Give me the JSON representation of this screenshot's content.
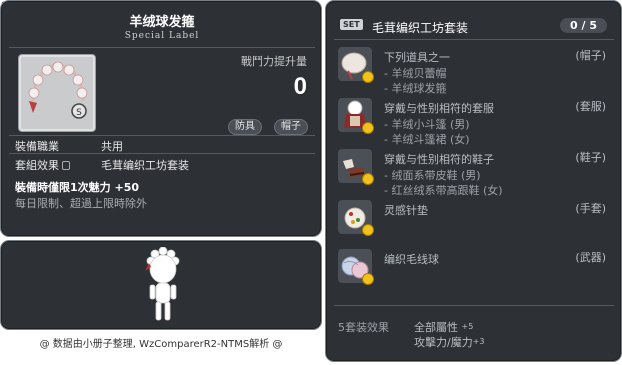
{
  "item_id": "01006161",
  "item": {
    "name": "羊绒球发箍",
    "label": "Special Label",
    "power_label": "戰鬥力提升量",
    "power_value": "0",
    "tags": [
      "防具",
      "帽子"
    ],
    "job_key": "裝備職業",
    "job_value": "共用",
    "set_key": "套組效果",
    "set_value": "毛茸编织工坊套装",
    "limit_text": "裝備時僅限1次魅力 +50",
    "reset_text": "每日限制、超過上限時除外"
  },
  "credit": "@ 数据由小册子整理, WzComparerR2-NTMS解析 @",
  "set": {
    "badge": "SET",
    "title": "毛茸编织工坊套装",
    "count": "0 / 5",
    "rows": [
      {
        "icon": "snowball-headband-icon",
        "head": "下列道具之一",
        "slot": "(帽子)",
        "subs": [
          "- 羊绒贝蕾帽",
          "- 羊绒球发箍"
        ]
      },
      {
        "icon": "knit-outfit-icon",
        "head": "穿戴与性别相符的套服",
        "slot": "(套服)",
        "subs": [
          "- 羊绒小斗篷 (男)",
          "- 羊绒斗篷裙 (女)"
        ]
      },
      {
        "icon": "knit-shoes-icon",
        "head": "穿戴与性别相符的鞋子",
        "slot": "(鞋子)",
        "subs": [
          "- 绒面系带皮鞋 (男)",
          "- 红丝绒系带高跟鞋 (女)"
        ]
      },
      {
        "icon": "pincushion-icon",
        "head": "灵感针垫",
        "slot": "(手套)",
        "subs": []
      },
      {
        "icon": "yarn-ball-icon",
        "head": "编织毛线球",
        "slot": "(武器)",
        "subs": []
      }
    ],
    "bonus_label": "5套装效果",
    "bonus": [
      {
        "text": "全部屬性 ",
        "value": "+5"
      },
      {
        "text": "攻擊力/魔力",
        "value": "+3"
      }
    ]
  }
}
